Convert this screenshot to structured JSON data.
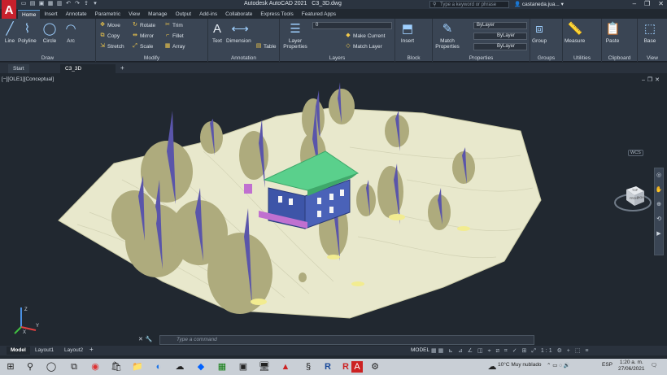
{
  "app": {
    "logo": "A",
    "title": "Autodesk AutoCAD 2021",
    "file": "C3_3D.dwg"
  },
  "search": {
    "placeholder": "Type a keyword or phrase"
  },
  "user": {
    "name": "castaneda.jua..."
  },
  "ribbon_tabs": [
    "Home",
    "Insert",
    "Annotate",
    "Parametric",
    "View",
    "Manage",
    "Output",
    "Add-ins",
    "Collaborate",
    "Express Tools",
    "Featured Apps"
  ],
  "draw": {
    "title": "Draw",
    "line": "Line",
    "polyline": "Polyline",
    "circle": "Circle",
    "arc": "Arc"
  },
  "modify": {
    "title": "Modify",
    "move": "Move",
    "rotate": "Rotate",
    "trim": "Trim",
    "copy": "Copy",
    "mirror": "Mirror",
    "fillet": "Fillet",
    "stretch": "Stretch",
    "scale": "Scale",
    "array": "Array"
  },
  "annotation": {
    "title": "Annotation",
    "text": "Text",
    "dimension": "Dimension",
    "table": "Table"
  },
  "layers": {
    "title": "Layers",
    "layer_props": "Layer Properties",
    "current": "0",
    "make_current": "Make Current",
    "match_layer": "Match Layer"
  },
  "block": {
    "title": "Block",
    "insert": "Insert"
  },
  "properties": {
    "title": "Properties",
    "match": "Match Properties",
    "bylayer1": "ByLayer",
    "bylayer2": "ByLayer",
    "bylayer3": "ByLayer"
  },
  "groups": {
    "title": "Groups",
    "group": "Group"
  },
  "utilities": {
    "title": "Utilities",
    "measure": "Measure"
  },
  "clipboard": {
    "title": "Clipboard",
    "paste": "Paste"
  },
  "view": {
    "title": "View",
    "base": "Base"
  },
  "file_tabs": [
    "Start",
    "C3_3D"
  ],
  "viewport": {
    "label": "[−][OLE1][Conceptual]"
  },
  "wcs": "WCS",
  "command": {
    "placeholder": "Type a command"
  },
  "layout_tabs": [
    "Model",
    "Layout1",
    "Layout2"
  ],
  "status": {
    "model": "MODEL",
    "scale": "1:1"
  },
  "taskbar": {
    "weather": "10°C  Muy nublado",
    "lang": "ESP",
    "time": "1:20 a. m.",
    "date": "27/06/2021"
  },
  "colors": {
    "ground": "#e6e6c8",
    "roof": "#4fcf8a",
    "tree": "#aeab7d",
    "tree_shadow": "#5a55aa",
    "accent": "#c8202c"
  }
}
